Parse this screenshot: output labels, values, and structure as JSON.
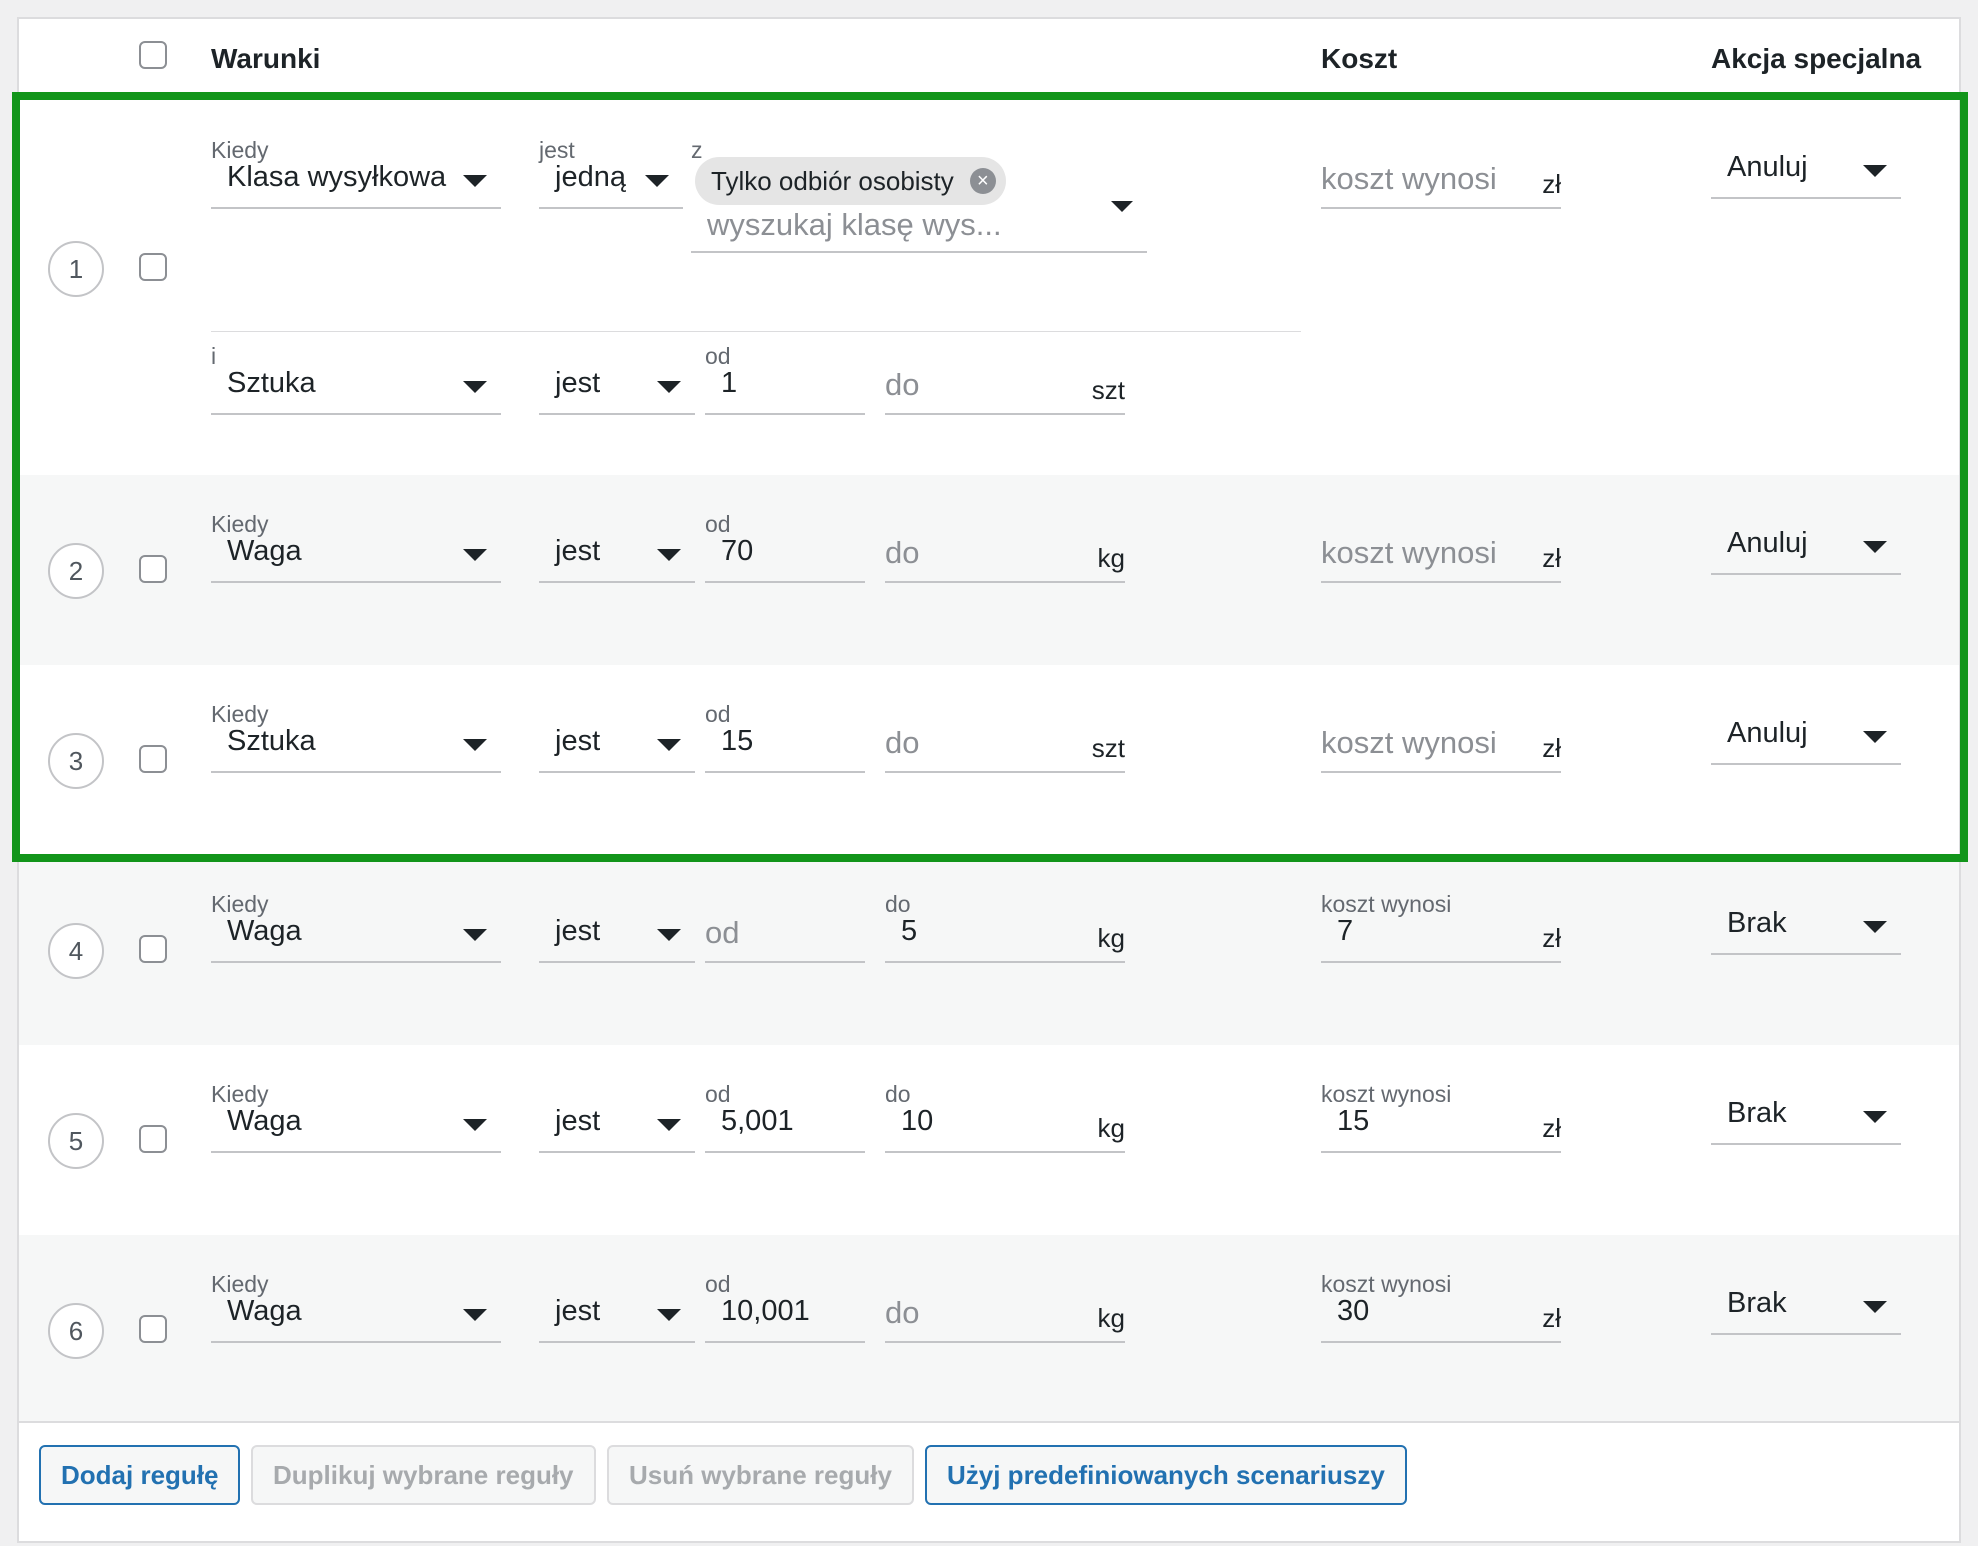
{
  "header": {
    "conditions": "Warunki",
    "cost": "Koszt",
    "special_action": "Akcja specjalna"
  },
  "labels": {
    "when": "Kiedy",
    "is": "jest",
    "from_z": "z",
    "and": "i",
    "od": "od",
    "do": "do",
    "cost_is": "koszt wynosi"
  },
  "rows": [
    {
      "num": "1",
      "condition": "Klasa wysyłkowa",
      "operator": "jedną",
      "chip": "Tylko odbiór osobisty",
      "search_placeholder": "wyszukaj klasę wys...",
      "cost_placeholder": "koszt wynosi",
      "currency": "zł",
      "action": "Anuluj",
      "sub": {
        "condition": "Sztuka",
        "operator": "jest",
        "from": "1",
        "to_placeholder": "do",
        "unit": "szt"
      }
    },
    {
      "num": "2",
      "condition": "Waga",
      "operator": "jest",
      "from": "70",
      "to_placeholder": "do",
      "unit": "kg",
      "cost_placeholder": "koszt wynosi",
      "currency": "zł",
      "action": "Anuluj"
    },
    {
      "num": "3",
      "condition": "Sztuka",
      "operator": "jest",
      "from": "15",
      "to_placeholder": "do",
      "unit": "szt",
      "cost_placeholder": "koszt wynosi",
      "currency": "zł",
      "action": "Anuluj"
    },
    {
      "num": "4",
      "condition": "Waga",
      "operator": "jest",
      "from_placeholder": "od",
      "to": "5",
      "unit": "kg",
      "cost": "7",
      "currency": "zł",
      "action": "Brak"
    },
    {
      "num": "5",
      "condition": "Waga",
      "operator": "jest",
      "from": "5,001",
      "to": "10",
      "unit": "kg",
      "cost": "15",
      "currency": "zł",
      "action": "Brak"
    },
    {
      "num": "6",
      "condition": "Waga",
      "operator": "jest",
      "from": "10,001",
      "to_placeholder": "do",
      "unit": "kg",
      "cost": "30",
      "currency": "zł",
      "action": "Brak"
    }
  ],
  "footer": {
    "add_rule": "Dodaj regułę",
    "duplicate": "Duplikuj wybrane reguły",
    "delete": "Usuń wybrane reguły",
    "predefined": "Użyj predefiniowanych scenariuszy"
  },
  "colors": {
    "highlight": "#12951a",
    "primary": "#2271b1",
    "disabled": "#a7aaad"
  }
}
